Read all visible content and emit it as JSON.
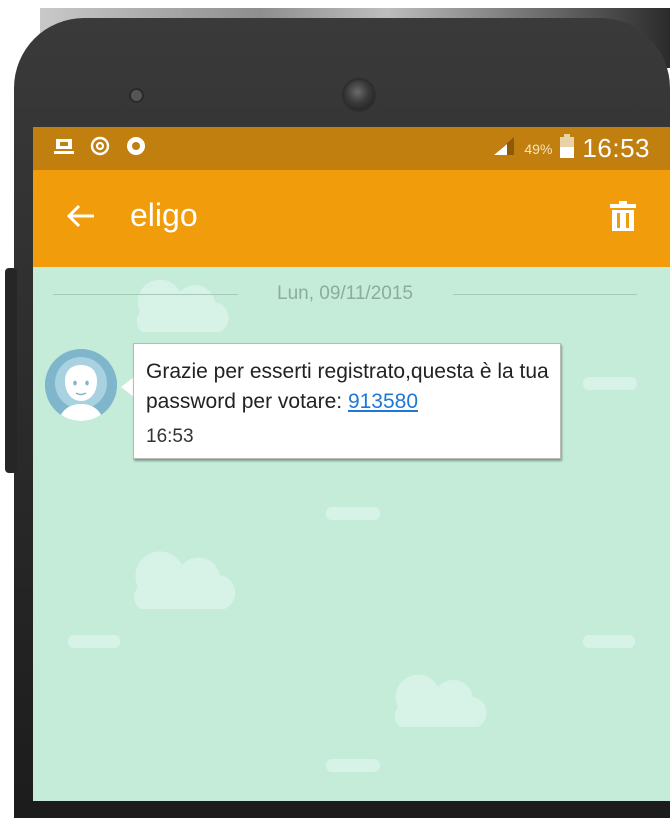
{
  "status_bar": {
    "left_icons": [
      "briefcase-notification-icon",
      "sync-icon",
      "circle-notification-icon"
    ],
    "battery_percent": "49%",
    "time": "16:53"
  },
  "app_bar": {
    "title": "eligo",
    "back_icon": "arrow-left-icon",
    "delete_icon": "trash-icon"
  },
  "conversation": {
    "date": "Lun, 09/11/2015",
    "messages": [
      {
        "text_before_link": "Grazie per esserti registrato,questa è la tua password per votare: ",
        "link": "913580",
        "time": "16:53"
      }
    ]
  },
  "colors": {
    "status_bar": "#c17f0f",
    "app_bar": "#f09c0b",
    "chat_background": "#c4ecd9",
    "link": "#1e78d6"
  }
}
